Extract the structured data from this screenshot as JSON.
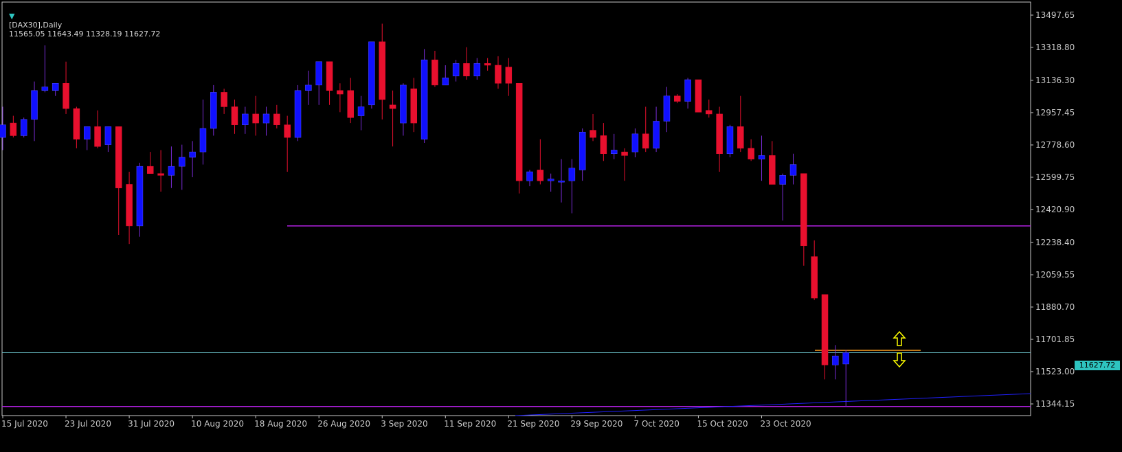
{
  "header": {
    "symbol": "[DAX30],Daily",
    "ohlc": "11565.05 11643.49 11328.19 11627.72"
  },
  "current_price_label": "11627.72",
  "colors": {
    "bullish": "#1010ff",
    "bearish": "#e8102e",
    "wick_up": "#7a2cd8",
    "wick_down": "#e8102e",
    "support_line": "#b020e0",
    "trend_line": "#2020ff",
    "current_price_line": "#6fc9d0",
    "orange_line": "#ffa020",
    "arrow": "#ffff00",
    "axis": "#c8c8c8",
    "background": "#000000"
  },
  "chart_data": {
    "type": "candlestick",
    "title": "[DAX30],Daily",
    "ylim": [
      11290,
      13560
    ],
    "y_ticks": [
      "13497.65",
      "13318.80",
      "13136.30",
      "12957.45",
      "12778.60",
      "12599.75",
      "12420.90",
      "12238.40",
      "12059.55",
      "11880.70",
      "11701.85",
      "11523.00",
      "11344.15"
    ],
    "x_ticks": [
      {
        "label": "15 Jul 2020",
        "index": 0
      },
      {
        "label": "23 Jul 2020",
        "index": 6
      },
      {
        "label": "31 Jul 2020",
        "index": 12
      },
      {
        "label": "10 Aug 2020",
        "index": 18
      },
      {
        "label": "18 Aug 2020",
        "index": 24
      },
      {
        "label": "26 Aug 2020",
        "index": 30
      },
      {
        "label": "3 Sep 2020",
        "index": 36
      },
      {
        "label": "11 Sep 2020",
        "index": 42
      },
      {
        "label": "21 Sep 2020",
        "index": 48
      },
      {
        "label": "29 Sep 2020",
        "index": 54
      },
      {
        "label": "7 Oct 2020",
        "index": 60
      },
      {
        "label": "15 Oct 2020",
        "index": 66
      },
      {
        "label": "23 Oct 2020",
        "index": 72
      }
    ],
    "candles": [
      {
        "o": 12820,
        "h": 12990,
        "l": 12750,
        "c": 12890
      },
      {
        "o": 12900,
        "h": 12940,
        "l": 12820,
        "c": 12830
      },
      {
        "o": 12830,
        "h": 12930,
        "l": 12820,
        "c": 12920
      },
      {
        "o": 12920,
        "h": 13130,
        "l": 12800,
        "c": 13080
      },
      {
        "o": 13080,
        "h": 13330,
        "l": 13070,
        "c": 13100
      },
      {
        "o": 13080,
        "h": 13120,
        "l": 13050,
        "c": 13120
      },
      {
        "o": 13120,
        "h": 13240,
        "l": 12950,
        "c": 12980
      },
      {
        "o": 12980,
        "h": 12990,
        "l": 12760,
        "c": 12810
      },
      {
        "o": 12810,
        "h": 12880,
        "l": 12750,
        "c": 12880
      },
      {
        "o": 12880,
        "h": 12970,
        "l": 12760,
        "c": 12770
      },
      {
        "o": 12780,
        "h": 12880,
        "l": 12740,
        "c": 12880
      },
      {
        "o": 12880,
        "h": 12880,
        "l": 12280,
        "c": 12540
      },
      {
        "o": 12560,
        "h": 12630,
        "l": 12230,
        "c": 12330
      },
      {
        "o": 12330,
        "h": 12680,
        "l": 12270,
        "c": 12660
      },
      {
        "o": 12660,
        "h": 12740,
        "l": 12620,
        "c": 12620
      },
      {
        "o": 12620,
        "h": 12750,
        "l": 12520,
        "c": 12610
      },
      {
        "o": 12610,
        "h": 12770,
        "l": 12540,
        "c": 12660
      },
      {
        "o": 12660,
        "h": 12780,
        "l": 12530,
        "c": 12710
      },
      {
        "o": 12710,
        "h": 12800,
        "l": 12600,
        "c": 12740
      },
      {
        "o": 12740,
        "h": 13030,
        "l": 12670,
        "c": 12870
      },
      {
        "o": 12870,
        "h": 13110,
        "l": 12830,
        "c": 13070
      },
      {
        "o": 13070,
        "h": 13090,
        "l": 12950,
        "c": 12990
      },
      {
        "o": 12990,
        "h": 13030,
        "l": 12840,
        "c": 12890
      },
      {
        "o": 12890,
        "h": 12990,
        "l": 12840,
        "c": 12950
      },
      {
        "o": 12950,
        "h": 13050,
        "l": 12830,
        "c": 12900
      },
      {
        "o": 12900,
        "h": 12990,
        "l": 12830,
        "c": 12950
      },
      {
        "o": 12950,
        "h": 13000,
        "l": 12870,
        "c": 12890
      },
      {
        "o": 12890,
        "h": 12940,
        "l": 12630,
        "c": 12820
      },
      {
        "o": 12820,
        "h": 13110,
        "l": 12800,
        "c": 13080
      },
      {
        "o": 13080,
        "h": 13190,
        "l": 13000,
        "c": 13110
      },
      {
        "o": 13110,
        "h": 13240,
        "l": 13000,
        "c": 13240
      },
      {
        "o": 13240,
        "h": 13210,
        "l": 13000,
        "c": 13080
      },
      {
        "o": 13080,
        "h": 13120,
        "l": 12960,
        "c": 13060
      },
      {
        "o": 13080,
        "h": 13150,
        "l": 12900,
        "c": 12930
      },
      {
        "o": 12940,
        "h": 13050,
        "l": 12860,
        "c": 12990
      },
      {
        "o": 13000,
        "h": 13350,
        "l": 12980,
        "c": 13350
      },
      {
        "o": 13350,
        "h": 13450,
        "l": 12920,
        "c": 13030
      },
      {
        "o": 13000,
        "h": 13080,
        "l": 12770,
        "c": 12980
      },
      {
        "o": 12900,
        "h": 13120,
        "l": 12830,
        "c": 13110
      },
      {
        "o": 13090,
        "h": 13150,
        "l": 12850,
        "c": 12900
      },
      {
        "o": 12810,
        "h": 13310,
        "l": 12790,
        "c": 13250
      },
      {
        "o": 13250,
        "h": 13300,
        "l": 13100,
        "c": 13110
      },
      {
        "o": 13110,
        "h": 13220,
        "l": 13120,
        "c": 13150
      },
      {
        "o": 13160,
        "h": 13250,
        "l": 13130,
        "c": 13230
      },
      {
        "o": 13230,
        "h": 13320,
        "l": 13140,
        "c": 13160
      },
      {
        "o": 13160,
        "h": 13260,
        "l": 13140,
        "c": 13230
      },
      {
        "o": 13230,
        "h": 13260,
        "l": 13190,
        "c": 13220
      },
      {
        "o": 13220,
        "h": 13270,
        "l": 13090,
        "c": 13120
      },
      {
        "o": 13210,
        "h": 13260,
        "l": 13050,
        "c": 13120
      },
      {
        "o": 13120,
        "h": 13080,
        "l": 12510,
        "c": 12580
      },
      {
        "o": 12580,
        "h": 12640,
        "l": 12550,
        "c": 12630
      },
      {
        "o": 12640,
        "h": 12810,
        "l": 12560,
        "c": 12580
      },
      {
        "o": 12580,
        "h": 12620,
        "l": 12520,
        "c": 12590
      },
      {
        "o": 12580,
        "h": 12700,
        "l": 12460,
        "c": 12580
      },
      {
        "o": 12580,
        "h": 12700,
        "l": 12400,
        "c": 12650
      },
      {
        "o": 12640,
        "h": 12870,
        "l": 12580,
        "c": 12850
      },
      {
        "o": 12860,
        "h": 12950,
        "l": 12800,
        "c": 12820
      },
      {
        "o": 12830,
        "h": 12900,
        "l": 12690,
        "c": 12730
      },
      {
        "o": 12730,
        "h": 12840,
        "l": 12700,
        "c": 12750
      },
      {
        "o": 12740,
        "h": 12760,
        "l": 12580,
        "c": 12720
      },
      {
        "o": 12740,
        "h": 12870,
        "l": 12710,
        "c": 12840
      },
      {
        "o": 12840,
        "h": 12990,
        "l": 12740,
        "c": 12760
      },
      {
        "o": 12760,
        "h": 12990,
        "l": 12740,
        "c": 12910
      },
      {
        "o": 12910,
        "h": 13100,
        "l": 12850,
        "c": 13050
      },
      {
        "o": 13050,
        "h": 13060,
        "l": 13010,
        "c": 13020
      },
      {
        "o": 13020,
        "h": 13150,
        "l": 12980,
        "c": 13140
      },
      {
        "o": 13140,
        "h": 13140,
        "l": 12970,
        "c": 12960
      },
      {
        "o": 12970,
        "h": 13030,
        "l": 12930,
        "c": 12950
      },
      {
        "o": 12950,
        "h": 12990,
        "l": 12630,
        "c": 12730
      },
      {
        "o": 12730,
        "h": 12890,
        "l": 12710,
        "c": 12880
      },
      {
        "o": 12880,
        "h": 13050,
        "l": 12740,
        "c": 12760
      },
      {
        "o": 12760,
        "h": 12810,
        "l": 12690,
        "c": 12700
      },
      {
        "o": 12700,
        "h": 12830,
        "l": 12580,
        "c": 12720
      },
      {
        "o": 12720,
        "h": 12800,
        "l": 12560,
        "c": 12560
      },
      {
        "o": 12560,
        "h": 12620,
        "l": 12360,
        "c": 12610
      },
      {
        "o": 12610,
        "h": 12730,
        "l": 12560,
        "c": 12670
      },
      {
        "o": 12620,
        "h": 12620,
        "l": 12110,
        "c": 12220
      },
      {
        "o": 12160,
        "h": 12250,
        "l": 11920,
        "c": 11930
      },
      {
        "o": 11950,
        "h": 11950,
        "l": 11480,
        "c": 11560
      },
      {
        "o": 11560,
        "h": 11670,
        "l": 11480,
        "c": 11610
      },
      {
        "o": 11565.05,
        "h": 11643.49,
        "l": 11328.19,
        "c": 11627.72
      }
    ],
    "lines": {
      "support_upper": 12330,
      "support_lower": 11330,
      "current_price": 11627.72,
      "orange_level": 11641
    },
    "legend": "none",
    "grid": false
  }
}
